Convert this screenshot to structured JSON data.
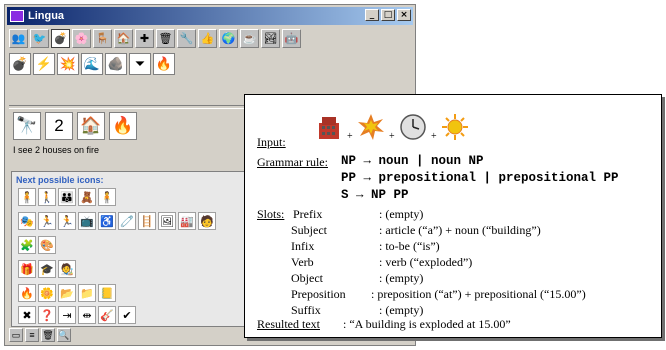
{
  "window": {
    "title": "Lingua",
    "controls": [
      "_",
      "□",
      "×"
    ]
  },
  "toolbar": {
    "icons": [
      "people-icon",
      "bird-icon",
      "bomb-icon",
      "flower-icon",
      "chairs-icon",
      "house-icon",
      "medical-cross-icon",
      "trash-can-icon",
      "tools-icon",
      "gesture-icon",
      "globe-icon",
      "cup-icon",
      "landscape-icon",
      "robot-icon"
    ],
    "glyphs": [
      "👥",
      "🐦",
      "💣",
      "🌸",
      "🪑",
      "🏠",
      "✚",
      "🗑",
      "🔧",
      "👍",
      "🌍",
      "☕",
      "🏞",
      "🤖"
    ]
  },
  "category_icons": {
    "icons": [
      "bomb-icon",
      "lightning-icon",
      "explosion-icon",
      "wave-icon",
      "rock-icon",
      "funnel-icon",
      "fire-icon"
    ],
    "glyphs": [
      "💣",
      "⚡",
      "💥",
      "🌊",
      "🪨",
      "⏷",
      "🔥"
    ]
  },
  "sentence": {
    "icons": [
      "binoculars-icon",
      "number-two-icon",
      "house-icon",
      "fire-icon"
    ],
    "glyphs": [
      "🔭",
      "2",
      "🏠",
      "🔥"
    ],
    "text": "I see 2 houses on fire"
  },
  "next_icons": {
    "title": "Next possible icons:",
    "rows": [
      [
        "🧍",
        "🚶",
        "👪",
        "🧸",
        "🧍"
      ],
      [
        "🎭",
        "🏃",
        "🏃",
        "📺",
        "♿",
        "🧷",
        "🪜",
        "🖼",
        "🏭",
        "🧑"
      ],
      [
        "🧩",
        "🎨"
      ],
      [
        "🎁",
        "🎓",
        "🧑‍🎨"
      ],
      [
        "🔥",
        "🌼",
        "📂",
        "📁",
        "📒"
      ],
      [
        "✖",
        "❓",
        "⇥",
        "⇹",
        "🎸",
        "✔"
      ]
    ]
  },
  "statusbar": {
    "icons": [
      "new-page-icon",
      "list-icon",
      "trash-icon",
      "search-icon"
    ],
    "glyphs": [
      "▭",
      "≡",
      "🗑",
      "🔍"
    ]
  },
  "overlay": {
    "input_label": "Input:",
    "grammar_label": "Grammar rule:",
    "grammar_lines": [
      "NP → noun | noun NP",
      "PP → prepositional | prepositional PP",
      "S → NP PP"
    ],
    "slots_label": "Slots:",
    "slots": [
      {
        "name": "Prefix",
        "value": ": (empty)"
      },
      {
        "name": "Subject",
        "value": ": article (“a”) + noun (“building”)"
      },
      {
        "name": "Infix",
        "value": ": to-be (“is”)"
      },
      {
        "name": "Verb",
        "value": ": verb (“exploded”)"
      },
      {
        "name": "Object",
        "value": ": (empty)"
      },
      {
        "name": "Preposition",
        "value": ": preposition (“at”) + prepositional (“15.00”)"
      },
      {
        "name": "Suffix",
        "value": ": (empty)"
      }
    ],
    "result_label": "Resulted text",
    "result_value": ": “A building is exploded at 15.00”",
    "plus": "+"
  }
}
